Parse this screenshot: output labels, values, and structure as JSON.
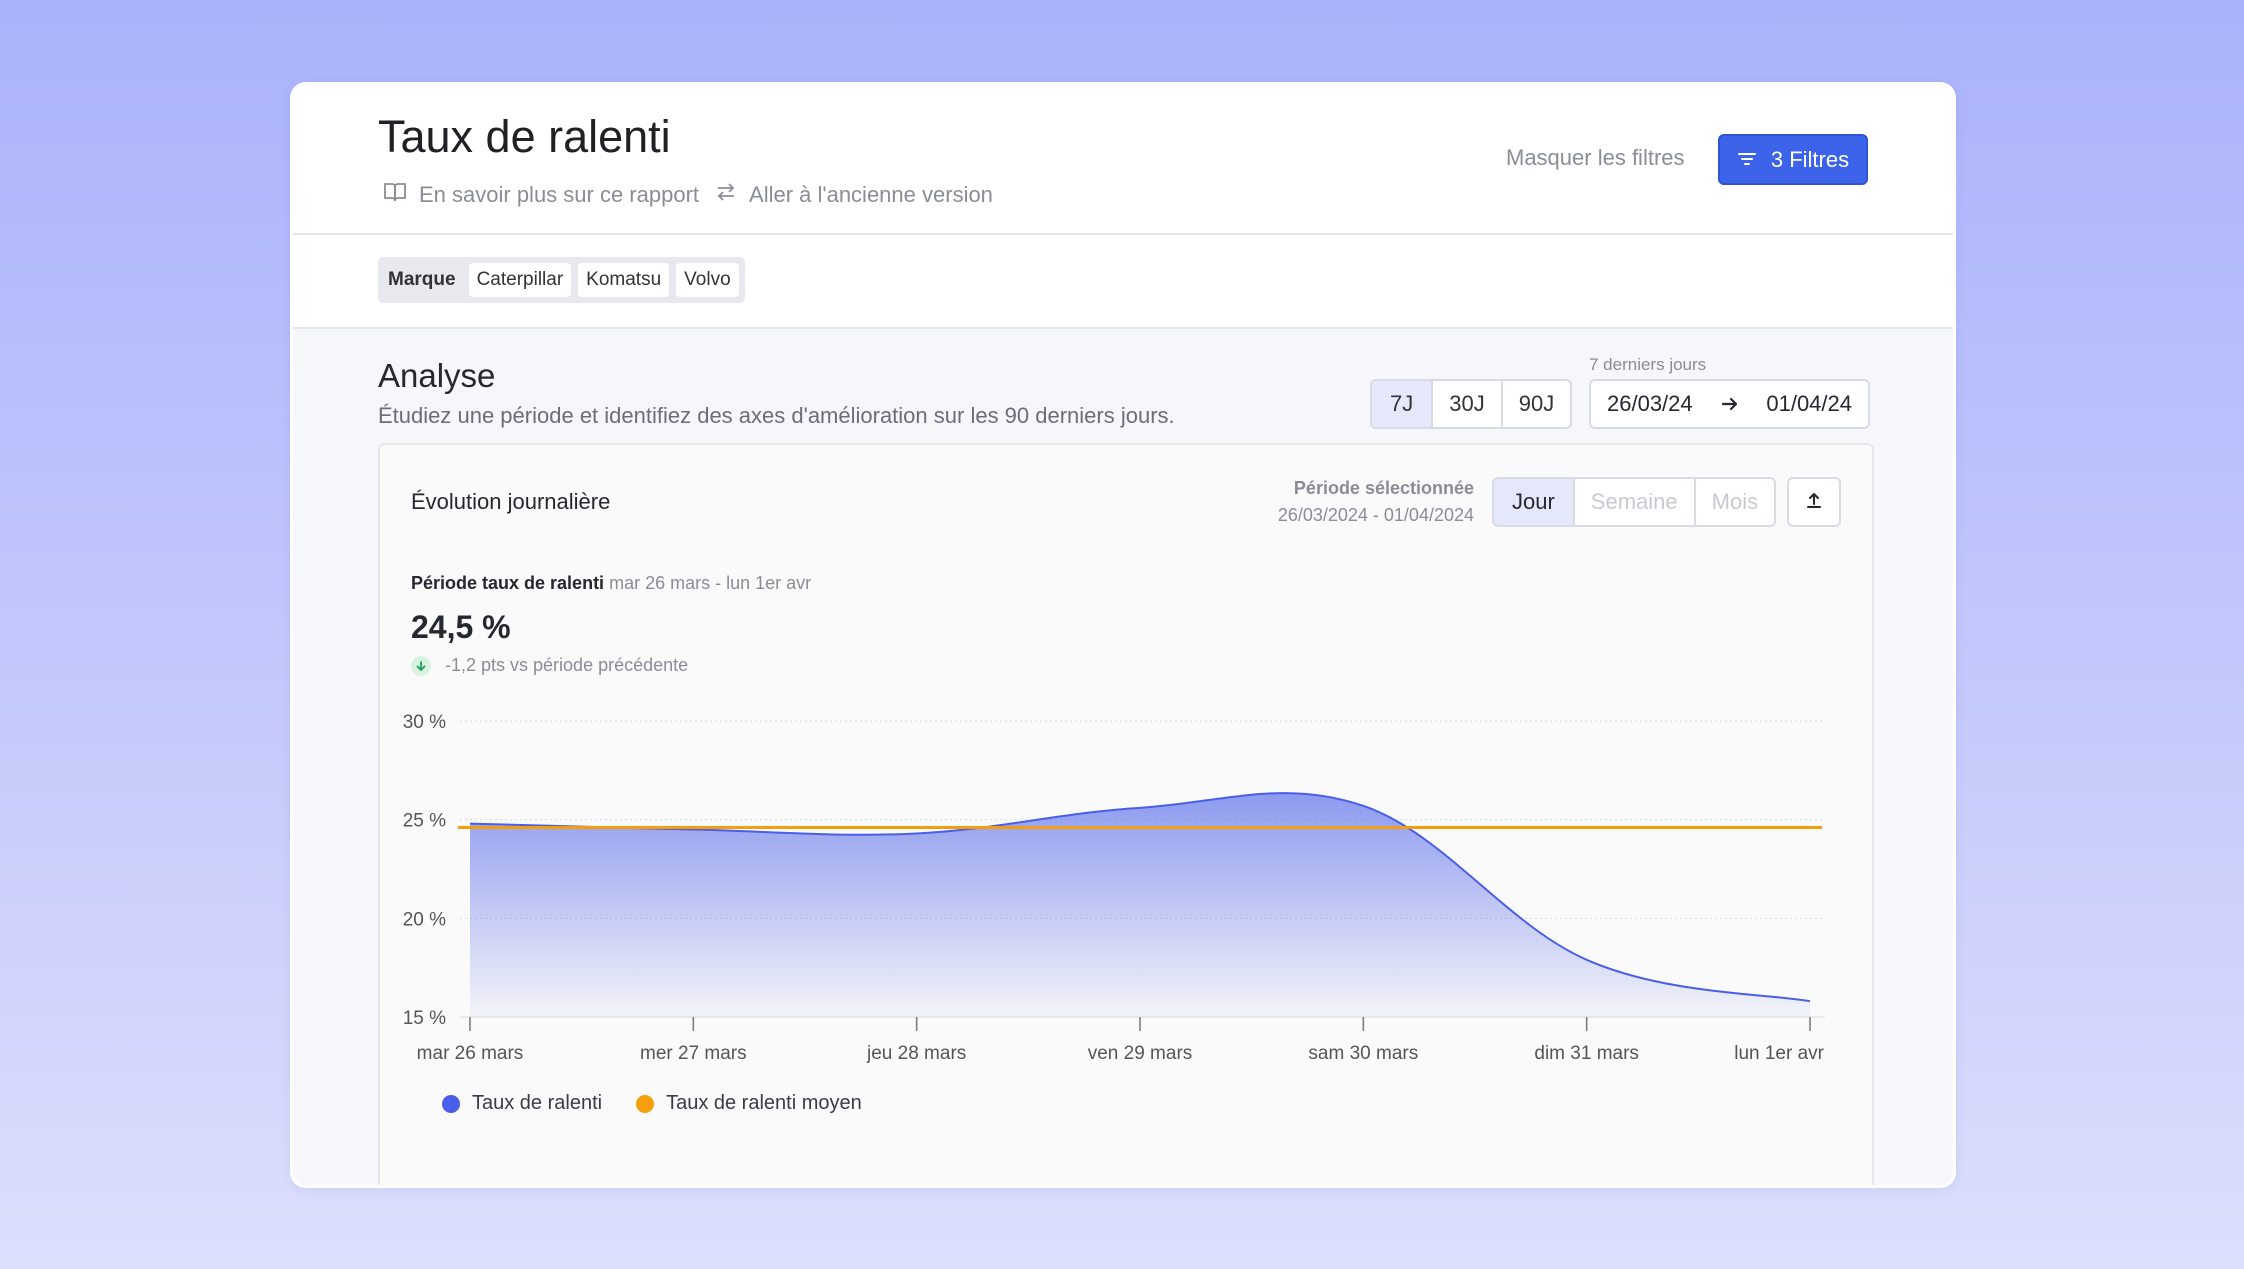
{
  "header": {
    "title": "Taux de ralenti",
    "learn_more": "En savoir plus sur ce rapport",
    "old_version": "Aller à l'ancienne version",
    "hide_filters": "Masquer les filtres",
    "filters_button": "3 Filtres"
  },
  "filters": {
    "key": "Marque",
    "values": [
      "Caterpillar",
      "Komatsu",
      "Volvo"
    ]
  },
  "analysis": {
    "title": "Analyse",
    "subtitle": "Étudiez une période et identifiez des axes d'amélioration sur les 90 derniers jours.",
    "ranges": [
      "7J",
      "30J",
      "90J"
    ],
    "active_range": "7J",
    "date_caption": "7 derniers jours",
    "date_start": "26/03/24",
    "date_end": "01/04/24"
  },
  "chart_card": {
    "title": "Évolution journalière",
    "selected_period_label": "Période sélectionnée",
    "selected_period_value": "26/03/2024 - 01/04/2024",
    "granularity": [
      "Jour",
      "Semaine",
      "Mois"
    ],
    "active_granularity": "Jour",
    "kpi_label": "Période taux de ralenti",
    "kpi_range": "mar 26 mars - lun 1er avr",
    "kpi_value": "24,5 %",
    "kpi_delta": "-1,2 pts vs période précédente"
  },
  "colors": {
    "accent": "#3d63ea",
    "series_primary": "#4a5fe8",
    "series_average": "#f59e0b",
    "delta_positive": "#1e9e57"
  },
  "icons": {
    "learn_more": "book-icon",
    "old_version": "swap-arrows-icon",
    "filters": "filter-lines-icon",
    "date_arrow": "arrow-right-icon",
    "export": "upload-icon",
    "delta": "arrow-down-icon"
  },
  "chart_data": {
    "type": "area",
    "x": [
      "mar 26 mars",
      "mer 27 mars",
      "jeu 28 mars",
      "ven 29 mars",
      "sam 30 mars",
      "dim 31 mars",
      "lun 1er avr"
    ],
    "series": [
      {
        "name": "Taux de ralenti",
        "type": "area",
        "values": [
          24.8,
          24.5,
          24.3,
          25.6,
          25.7,
          17.9,
          15.8
        ]
      },
      {
        "name": "Taux de ralenti moyen",
        "type": "line",
        "values": [
          24.6,
          24.6,
          24.6,
          24.6,
          24.6,
          24.6,
          24.6
        ]
      }
    ],
    "y_ticks": [
      "30 %",
      "25 %",
      "20 %",
      "15 %"
    ],
    "ylim": [
      15,
      30
    ],
    "grid": true,
    "legend": "bottom-left"
  }
}
